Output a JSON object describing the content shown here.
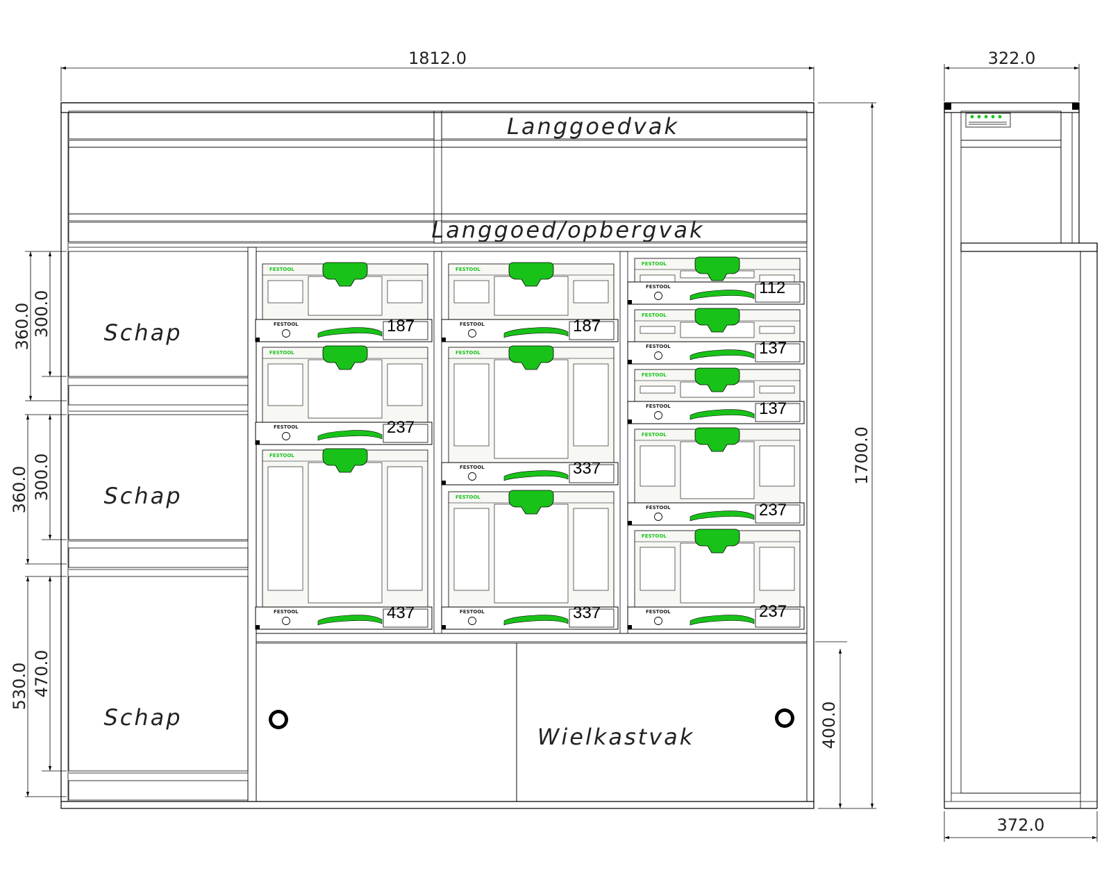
{
  "dimensions": {
    "overall_width": "1812.0",
    "overall_height": "1700.0",
    "side_top_depth": "322.0",
    "side_bottom_depth": "372.0",
    "shelf_1_outer": "360.0",
    "shelf_1_inner": "300.0",
    "shelf_2_outer": "360.0",
    "shelf_2_inner": "300.0",
    "shelf_3_outer": "530.0",
    "shelf_3_inner": "470.0",
    "wheel_height": "400.0"
  },
  "labels": {
    "top_compartment": "Langgoedvak",
    "second_compartment": "Langgoed/opbergvak",
    "shelf_1": "Schap",
    "shelf_2": "Schap",
    "shelf_3": "Schap",
    "wheel_compartment": "Wielkastvak"
  },
  "brand_text": "FESTOOL",
  "systainers": {
    "column_1": [
      "187",
      "237",
      "437"
    ],
    "column_2": [
      "187",
      "337",
      "337"
    ],
    "column_3": [
      "112",
      "137",
      "137",
      "237",
      "237"
    ]
  },
  "colors": {
    "systainer_green": "#19c219",
    "shelf_dark": "#7f7f7f",
    "panel_light": "#d9d9d9",
    "systainer_body": "#f7f7f4"
  }
}
